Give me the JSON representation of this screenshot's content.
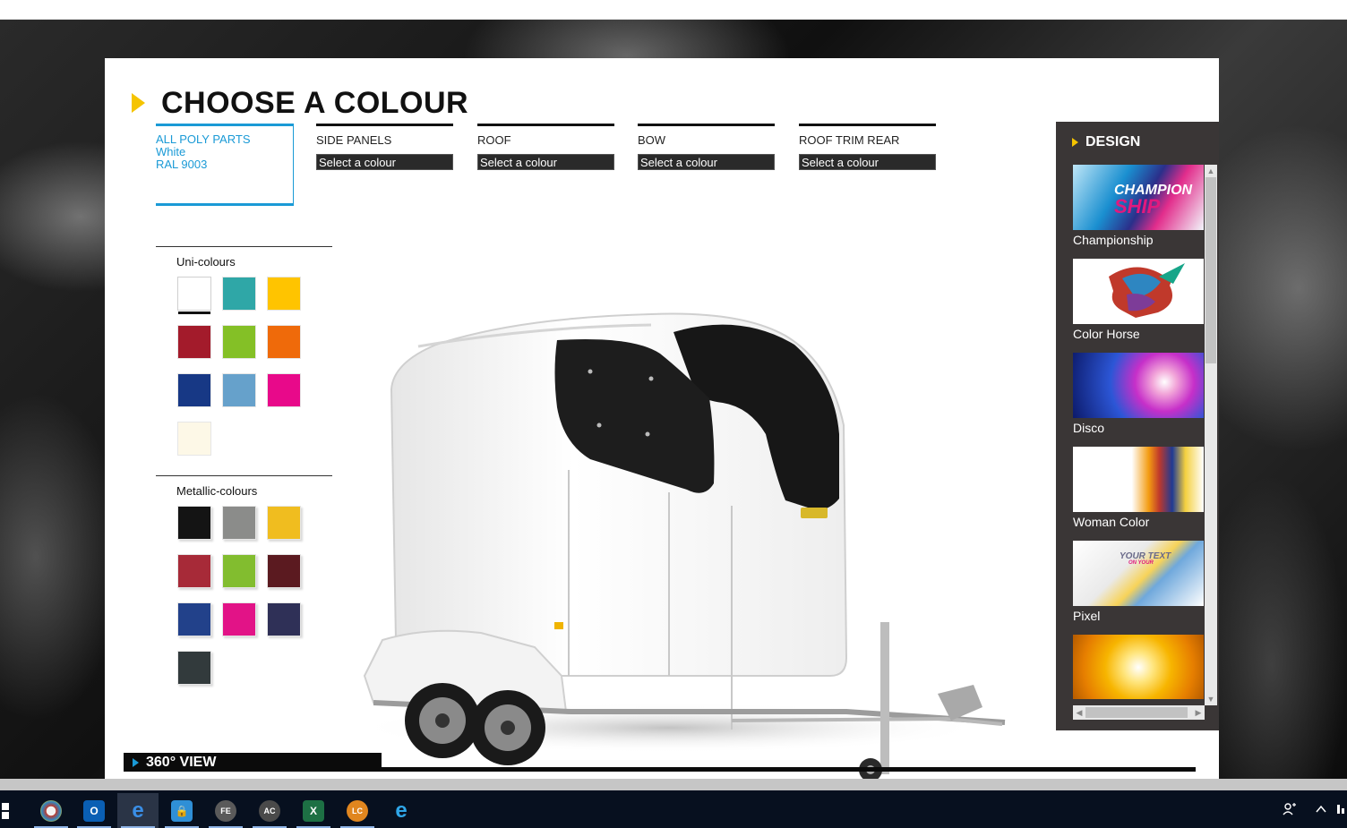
{
  "page": {
    "title": "CHOOSE A COLOUR"
  },
  "tabs": [
    {
      "name": "ALL POLY PARTS",
      "colour_name": "White",
      "colour_code": "RAL 9003",
      "active": true
    },
    {
      "name": "SIDE PANELS",
      "select_label": "Select a colour"
    },
    {
      "name": "ROOF",
      "select_label": "Select a colour"
    },
    {
      "name": "BOW",
      "select_label": "Select a colour"
    },
    {
      "name": "ROOF TRIM REAR",
      "select_label": "Select a colour"
    }
  ],
  "uni_colours": {
    "label": "Uni-colours",
    "swatches": [
      "#ffffff",
      "#2fa7a7",
      "#ffc400",
      "#a31b2b",
      "#84c026",
      "#ef6a0a",
      "#173885",
      "#66a1cb",
      "#e8098a",
      "#fdf8e7"
    ],
    "selected_index": 0
  },
  "metallic_colours": {
    "label": "Metallic-colours",
    "swatches": [
      "#141414",
      "#8b8c8a",
      "#f0bd1f",
      "#a72a38",
      "#82bd2f",
      "#5b1a20",
      "#22418a",
      "#e21387",
      "#2f3057",
      "#323a3c"
    ]
  },
  "view360": {
    "label": "360° VIEW"
  },
  "design": {
    "heading": "DESIGN",
    "items": [
      {
        "label": "Championship",
        "thumb_text_1": "CHAMPION",
        "thumb_text_2": "SHIP"
      },
      {
        "label": "Color Horse"
      },
      {
        "label": "Disco"
      },
      {
        "label": "Woman Color"
      },
      {
        "label": "Pixel",
        "thumb_text_1": "YOUR TEXT",
        "thumb_text_2": "ON YOUR"
      },
      {
        "label": ""
      }
    ]
  },
  "taskbar": {
    "apps": [
      "windows-start",
      "paint",
      "outlook",
      "edge",
      "vpn-lock",
      "app-fe",
      "app-ac",
      "excel",
      "app-lc",
      "internet-explorer"
    ],
    "active_app": "edge"
  },
  "colors": {
    "accent_blue": "#1a9ad6",
    "accent_yellow": "#f5c400"
  }
}
